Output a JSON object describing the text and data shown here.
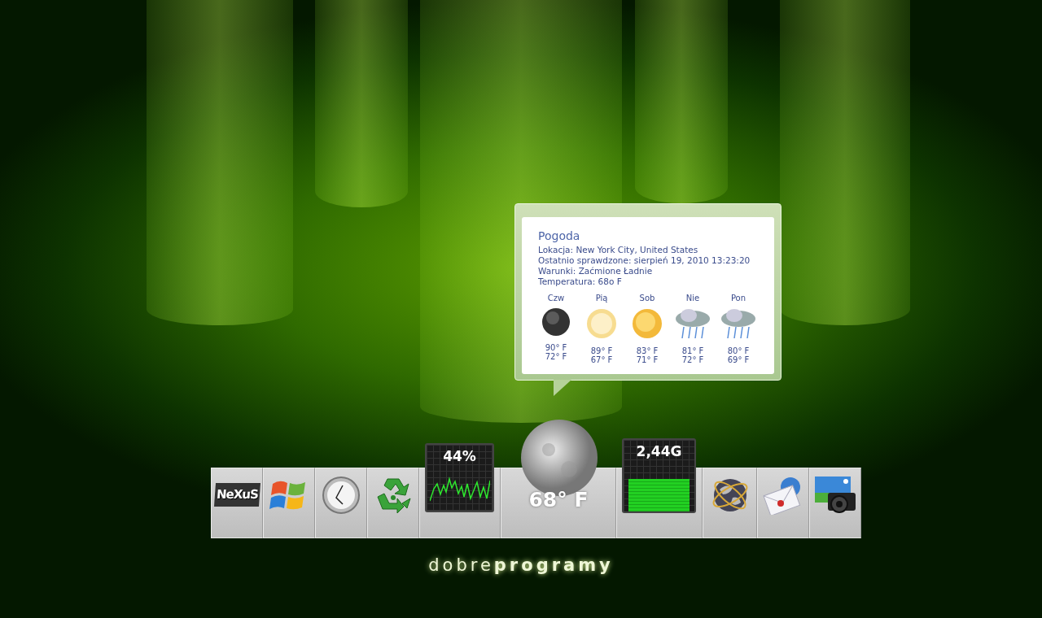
{
  "popup": {
    "title": "Pogoda",
    "lines": [
      "Lokacja: New York City, United States",
      "Ostatnio sprawdzone: sierpień 19, 2010 13:23:20",
      "Warunki: Zaćmione Ładnie",
      "Temperatura: 68o F"
    ],
    "forecast": [
      {
        "day": "Czw",
        "kind": "moon",
        "high": "90° F",
        "low": "72° F"
      },
      {
        "day": "Pią",
        "kind": "hazy-sun",
        "high": "89° F",
        "low": "67° F"
      },
      {
        "day": "Sob",
        "kind": "sun",
        "high": "83° F",
        "low": "71° F"
      },
      {
        "day": "Nie",
        "kind": "rain",
        "high": "81° F",
        "low": "72° F"
      },
      {
        "day": "Pon",
        "kind": "rain",
        "high": "80° F",
        "low": "69° F"
      }
    ]
  },
  "dock": {
    "items": [
      {
        "kind": "nexus",
        "logo_text": "NeXuS"
      },
      {
        "kind": "windows"
      },
      {
        "kind": "clock"
      },
      {
        "kind": "recycle"
      },
      {
        "kind": "cpu-meter",
        "reading": "44%"
      },
      {
        "kind": "weather",
        "reading": "68° F"
      },
      {
        "kind": "memory-meter",
        "reading": "2,44G",
        "level": 0.45
      },
      {
        "kind": "globe"
      },
      {
        "kind": "mail"
      },
      {
        "kind": "photo"
      }
    ]
  },
  "wallpaper": {
    "logo": "dobre**programy**"
  }
}
